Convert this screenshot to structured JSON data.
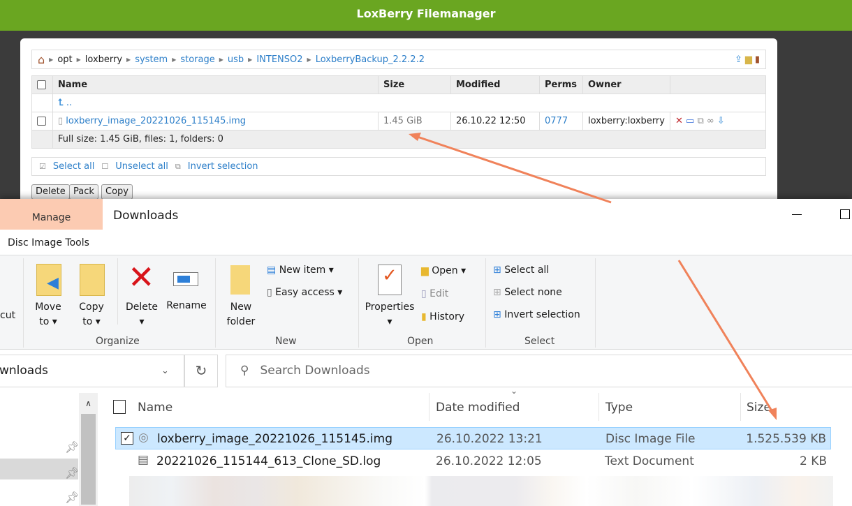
{
  "header": {
    "title": "LoxBerry Filemanager"
  },
  "breadcrumb": [
    "opt",
    "loxberry",
    "system",
    "storage",
    "usb",
    "INTENSO2",
    "LoxberryBackup_2.2.2.2"
  ],
  "table": {
    "columns": [
      "Name",
      "Size",
      "Modified",
      "Perms",
      "Owner"
    ],
    "parent": "..",
    "rows": [
      {
        "name": "loxberry_image_20221026_115145.img",
        "size": "1.45 GiB",
        "modified": "26.10.22 12:50",
        "perms": "0777",
        "owner": "loxberry:loxberry"
      }
    ],
    "summary": "Full size: 1.45 GiB, files: 1, folders: 0"
  },
  "selection": {
    "select_all": "Select all",
    "unselect_all": "Unselect all",
    "invert": "Invert selection"
  },
  "buttons": {
    "delete": "Delete",
    "pack": "Pack",
    "copy": "Copy"
  },
  "explorer": {
    "context_tab": "Manage",
    "context_group": "Disc Image Tools",
    "title": "Downloads",
    "ribbon": {
      "cut": "cut",
      "move_to": "Move to",
      "copy_to": "Copy to",
      "delete": "Delete",
      "rename": "Rename",
      "new_folder": "New folder",
      "new_item": "New item",
      "easy_access": "Easy access",
      "properties": "Properties",
      "open": "Open",
      "edit": "Edit",
      "history": "History",
      "select_all": "Select all",
      "select_none": "Select none",
      "invert_selection": "Invert selection",
      "groups": {
        "organize": "Organize",
        "new": "New",
        "open": "Open",
        "select": "Select"
      }
    },
    "address": "wnloads",
    "search_placeholder": "Search Downloads",
    "columns": [
      "Name",
      "Date modified",
      "Type",
      "Size"
    ],
    "files": [
      {
        "name": "loxberry_image_20221026_115145.img",
        "date": "26.10.2022 13:21",
        "type": "Disc Image File",
        "size": "1.525.539 KB",
        "selected": true
      },
      {
        "name": "20221026_115144_613_Clone_SD.log",
        "date": "26.10.2022 12:05",
        "type": "Text Document",
        "size": "2 KB",
        "selected": false
      }
    ]
  },
  "colors": {
    "header": "#6aa621",
    "manage_tab": "#fccbb2",
    "arrow": "#f0825a",
    "selection": "#cce8ff"
  }
}
